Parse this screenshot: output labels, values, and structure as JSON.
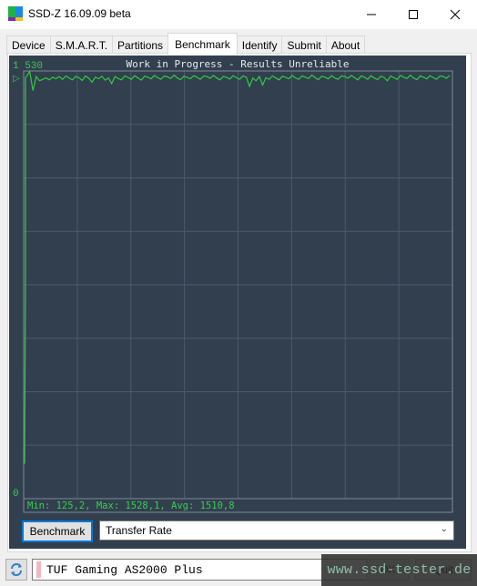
{
  "window": {
    "title": "SSD-Z 16.09.09 beta",
    "minimize_icon": "minimize-icon",
    "maximize_icon": "maximize-icon",
    "close_icon": "close-icon"
  },
  "tabs": [
    {
      "label": "Device",
      "active": false
    },
    {
      "label": "S.M.A.R.T.",
      "active": false
    },
    {
      "label": "Partitions",
      "active": false
    },
    {
      "label": "Benchmark",
      "active": true
    },
    {
      "label": "Identify",
      "active": false
    },
    {
      "label": "Submit",
      "active": false
    },
    {
      "label": "About",
      "active": false
    }
  ],
  "colors": {
    "chart_bg": "#323f4f",
    "grid": "#4a5a6c",
    "series": "#2ecc40",
    "label_green": "#33d14a",
    "title_text": "#e8e8e8"
  },
  "benchmark": {
    "button_label": "Benchmark",
    "mode_selected": "Transfer Rate",
    "status_text": "Min: 125,2, Max: 1528,1, Avg: 1510,8"
  },
  "chart_data": {
    "type": "line",
    "title": "Work in Progress - Results Unreliable",
    "y_max_label": "1 530",
    "y_min_label": "0",
    "ylim": [
      0,
      1530
    ],
    "xlabel": "",
    "ylabel": "",
    "grid": true,
    "marker_label": "▷",
    "summary": {
      "min": 125.2,
      "max": 1528.1,
      "avg": 1510.8
    },
    "series": [
      {
        "name": "Transfer Rate",
        "values": [
          125,
          770,
          1505,
          1528,
          1460,
          1510,
          1495,
          1500,
          1505,
          1498,
          1508,
          1502,
          1510,
          1500,
          1512,
          1505,
          1498,
          1510,
          1506,
          1496,
          1512,
          1504,
          1490,
          1508,
          1502,
          1511,
          1497,
          1505,
          1485,
          1510,
          1503,
          1498,
          1512,
          1507,
          1500,
          1513,
          1505,
          1497,
          1511,
          1508,
          1502,
          1514,
          1506,
          1500,
          1512,
          1509,
          1503,
          1515,
          1505,
          1499,
          1511,
          1507,
          1502,
          1513,
          1508,
          1500,
          1512,
          1510,
          1504,
          1514,
          1505,
          1498,
          1510,
          1507,
          1501,
          1513,
          1506,
          1500,
          1512,
          1508,
          1475,
          1505,
          1495,
          1510,
          1480,
          1506,
          1500,
          1512,
          1505,
          1498,
          1511,
          1507,
          1502,
          1514,
          1505,
          1500,
          1512,
          1508,
          1503,
          1515,
          1506,
          1499,
          1511,
          1508,
          1502,
          1513,
          1505,
          1500,
          1512,
          1510,
          1504,
          1514,
          1506,
          1498,
          1512,
          1508,
          1500,
          1513,
          1505,
          1499,
          1511,
          1507,
          1495,
          1512,
          1506,
          1500,
          1514,
          1508,
          1503,
          1515,
          1505,
          1499,
          1512,
          1508,
          1502,
          1513,
          1506,
          1500,
          1512,
          1510,
          1504,
          1514
        ]
      }
    ]
  },
  "bottom_bar": {
    "refresh_icon": "refresh-icon",
    "drive_name": "TUF Gaming AS2000 Plus",
    "ok_label": "OK",
    "quit_label": "Quit"
  },
  "watermark": "www.ssd-tester.de"
}
